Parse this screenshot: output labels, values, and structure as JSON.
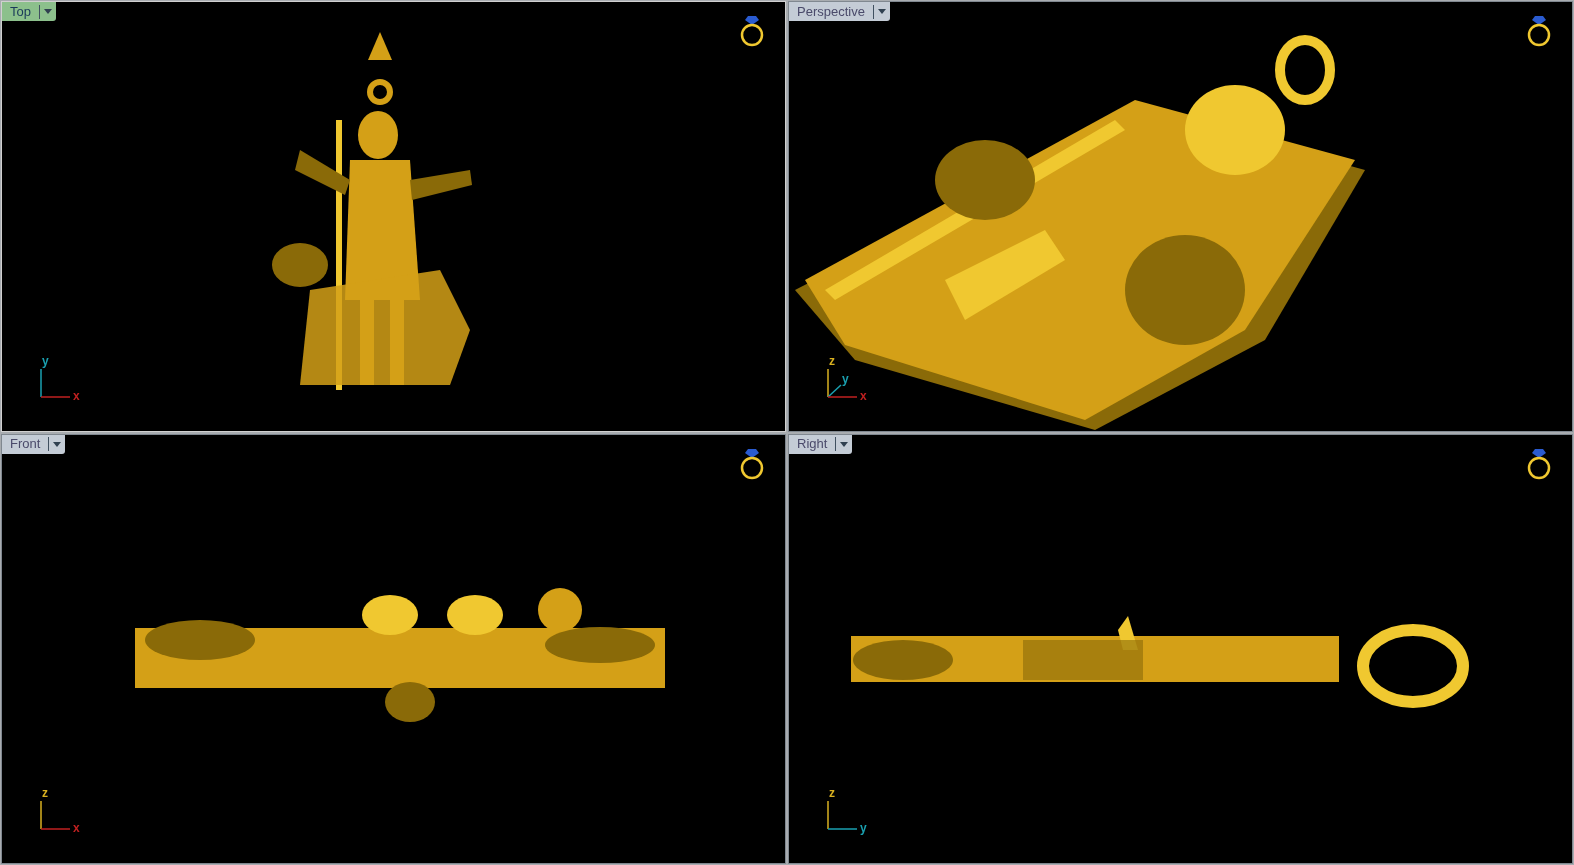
{
  "viewports": [
    {
      "title": "Top",
      "selected": true,
      "axes": [
        {
          "kind": "vertical",
          "label": "y",
          "color": "#1aa0b0"
        },
        {
          "kind": "horizontal",
          "label": "x",
          "color": "#c02020"
        }
      ]
    },
    {
      "title": "Perspective",
      "selected": false,
      "axes": [
        {
          "kind": "vertical",
          "label": "z",
          "color": "#d8b020"
        },
        {
          "kind": "diagonal",
          "label": "y",
          "color": "#1aa0b0"
        },
        {
          "kind": "horizontal",
          "label": "x",
          "color": "#c02020"
        }
      ]
    },
    {
      "title": "Front",
      "selected": false,
      "axes": [
        {
          "kind": "vertical",
          "label": "z",
          "color": "#d8b020"
        },
        {
          "kind": "horizontal",
          "label": "x",
          "color": "#c02020"
        }
      ]
    },
    {
      "title": "Right",
      "selected": false,
      "axes": [
        {
          "kind": "vertical",
          "label": "z",
          "color": "#d8b020"
        },
        {
          "kind": "horizontal",
          "label": "y",
          "color": "#1aa0b0"
        }
      ]
    }
  ]
}
